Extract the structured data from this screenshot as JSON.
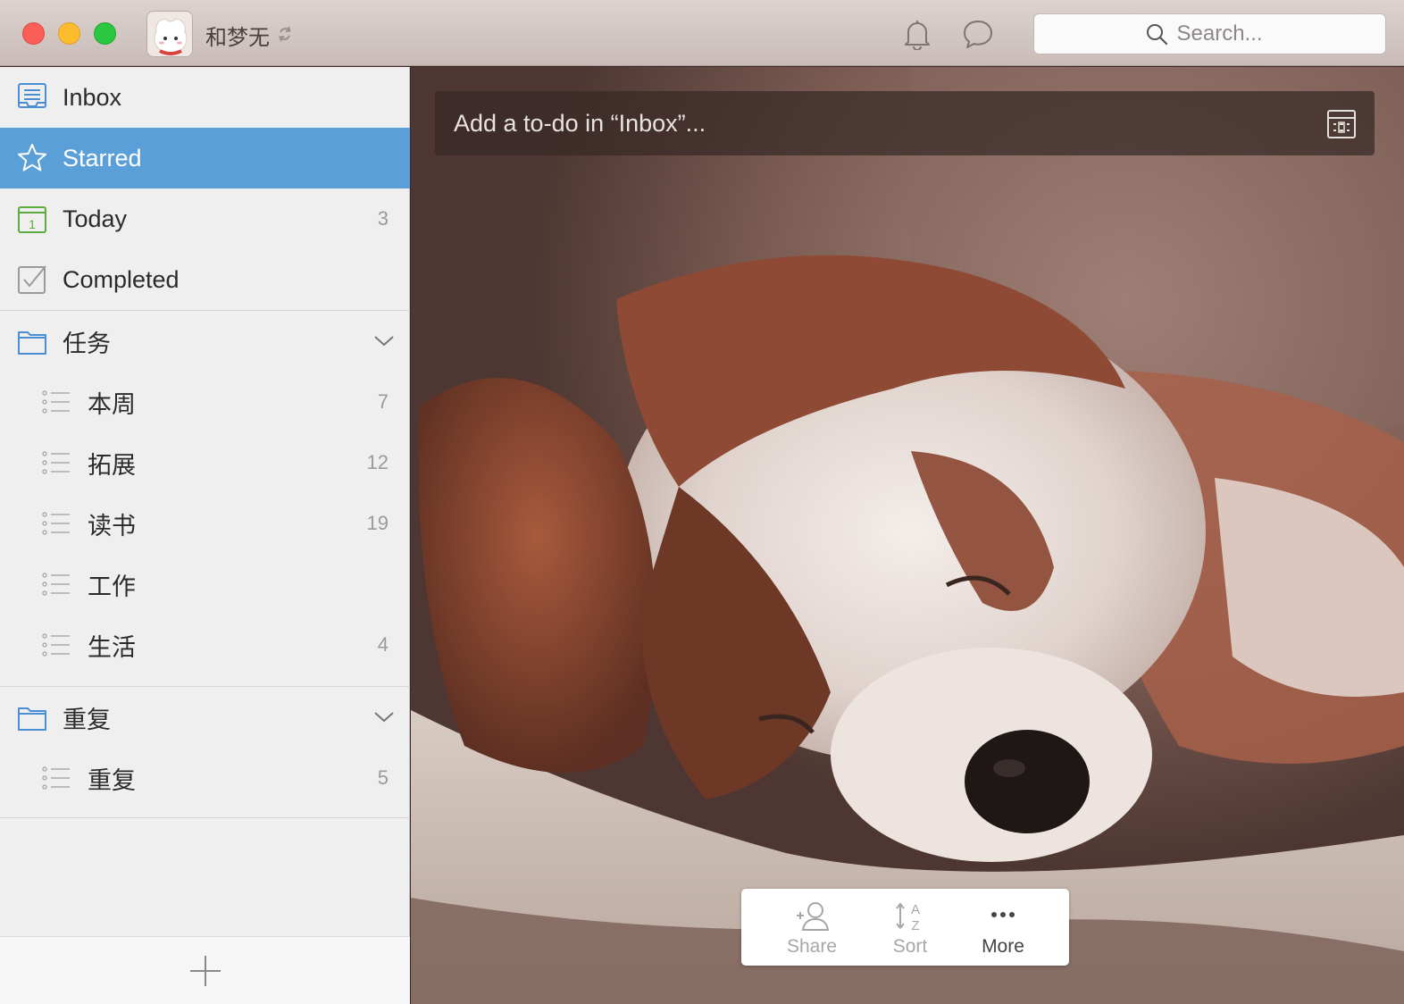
{
  "titlebar": {
    "username": "和梦无",
    "search_placeholder": "Search..."
  },
  "sidebar": {
    "smart_lists": [
      {
        "label": "Inbox",
        "count": "",
        "icon": "inbox-icon"
      },
      {
        "label": "Starred",
        "count": "",
        "icon": "star-icon",
        "active": true
      },
      {
        "label": "Today",
        "count": "3",
        "icon": "calendar-today-icon"
      },
      {
        "label": "Completed",
        "count": "",
        "icon": "checkbox-icon"
      }
    ],
    "folders": [
      {
        "label": "任务",
        "lists": [
          {
            "label": "本周",
            "count": "7"
          },
          {
            "label": "拓展",
            "count": "12"
          },
          {
            "label": "读书",
            "count": "19"
          },
          {
            "label": "工作",
            "count": ""
          },
          {
            "label": "生活",
            "count": "4"
          }
        ]
      },
      {
        "label": "重复",
        "lists": [
          {
            "label": "重复",
            "count": "5"
          }
        ]
      }
    ]
  },
  "main": {
    "add_todo_placeholder": "Add a to-do in “Inbox”...",
    "toolbar": {
      "share_label": "Share",
      "sort_label": "Sort",
      "more_label": "More"
    }
  },
  "colors": {
    "active_item": "#5b9fd9",
    "sidebar_bg": "#f0efef",
    "close": "#fc5f57",
    "minimize": "#fdbc2e",
    "zoom": "#29c840"
  }
}
